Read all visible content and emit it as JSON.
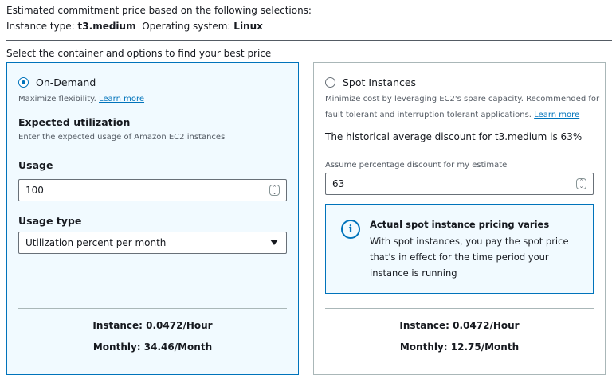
{
  "header": {
    "line1": "Estimated commitment price based on the following selections:",
    "instance_type_label": "Instance type:",
    "instance_type_value": "t3.medium",
    "os_label": "Operating system:",
    "os_value": "Linux",
    "section_label": "Select the container and options to find your best price"
  },
  "on_demand": {
    "selected": true,
    "label": "On-Demand",
    "description": "Maximize flexibility.",
    "learn_more": "Learn more",
    "expected_utilization_title": "Expected utilization",
    "expected_utilization_desc": "Enter the expected usage of Amazon EC2 instances",
    "usage_label": "Usage",
    "usage_value": "100",
    "usage_type_label": "Usage type",
    "usage_type_value": "Utilization percent per month",
    "instance_price": "Instance: 0.0472/Hour",
    "monthly_price": "Monthly: 34.46/Month"
  },
  "spot": {
    "selected": false,
    "label": "Spot Instances",
    "description_1": "Minimize cost by leveraging EC2's spare capacity. Recommended for",
    "description_2": "fault tolerant and interruption tolerant applications.",
    "learn_more": "Learn more",
    "historical_discount": "The historical average discount for t3.medium is 63%",
    "discount_label": "Assume percentage discount for my estimate",
    "discount_value": "63",
    "info_title": "Actual spot instance pricing varies",
    "info_body": "With spot instances, you pay the spot price that's in effect for the time period your instance is running",
    "instance_price": "Instance: 0.0472/Hour",
    "monthly_price": "Monthly: 12.75/Month"
  },
  "colors": {
    "accent": "#0073bb",
    "selected_bg": "#f1faff",
    "border": "#aab7b8",
    "text": "#16191f",
    "muted": "#545b64"
  },
  "icons": {
    "spinner": "stepper-icon",
    "dropdown": "caret-down-icon",
    "info": "info-icon"
  }
}
